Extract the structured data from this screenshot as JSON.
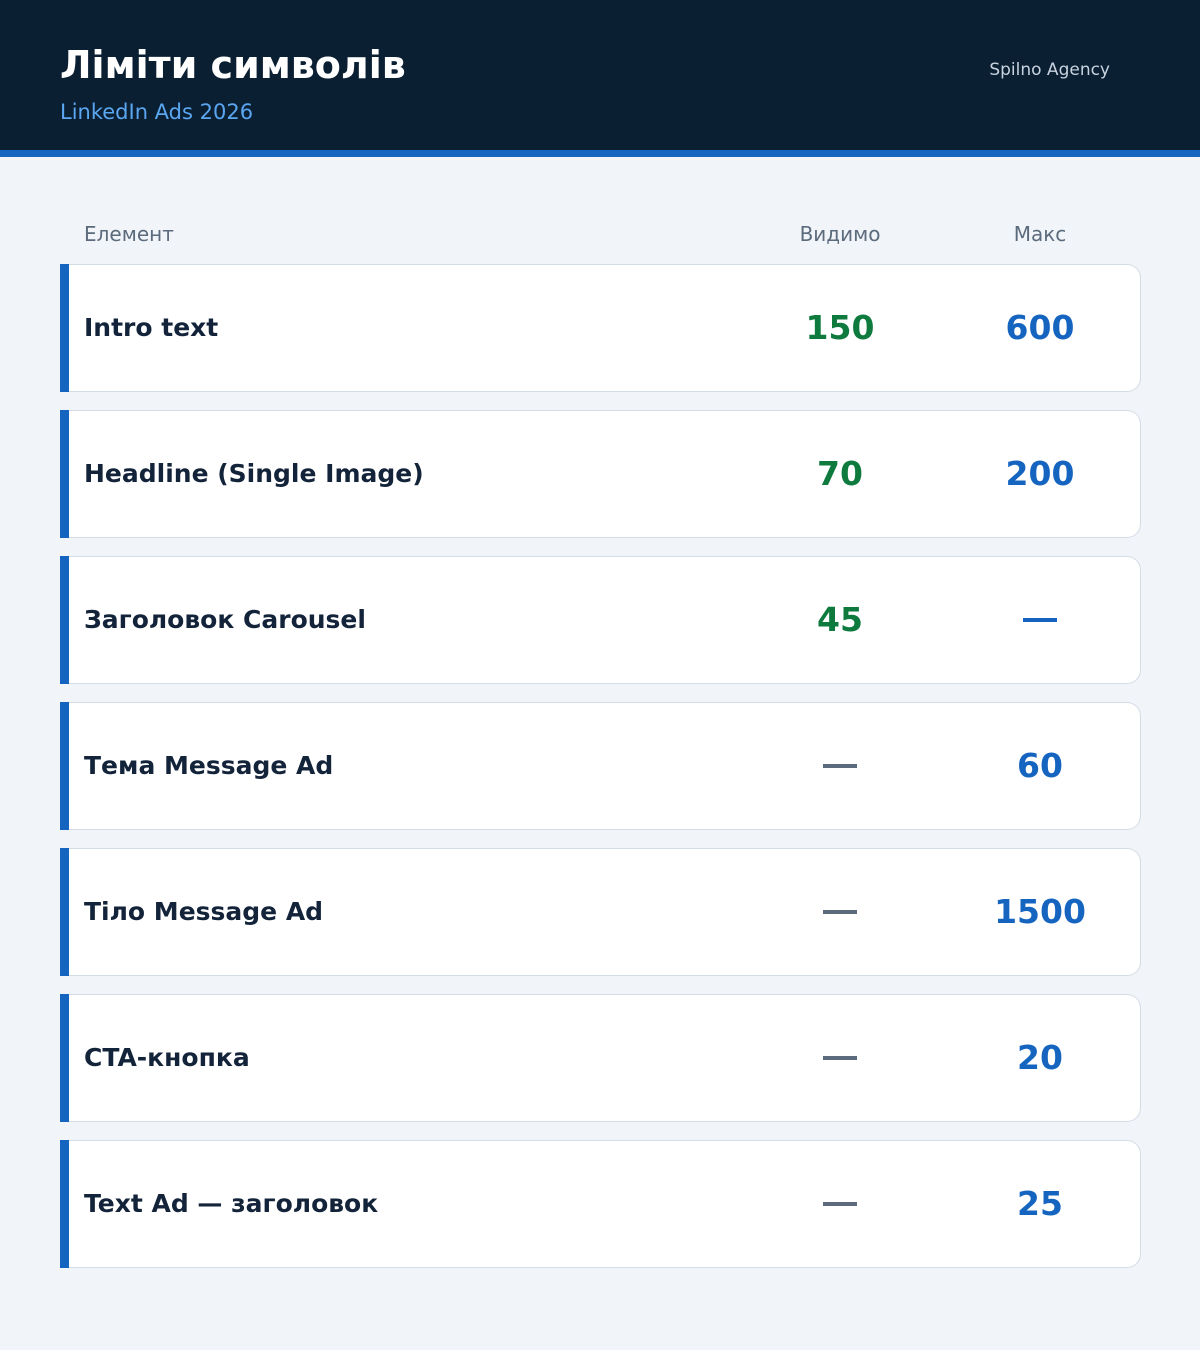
{
  "header": {
    "title": "Ліміти символів",
    "subtitle": "LinkedIn Ads 2026",
    "agency": "Spilno Agency"
  },
  "columns": {
    "element": "Елемент",
    "visible": "Видимо",
    "max": "Макс"
  },
  "rows": [
    {
      "label": "Intro text",
      "visible": "150",
      "max": "600"
    },
    {
      "label": "Headline (Single Image)",
      "visible": "70",
      "max": "200"
    },
    {
      "label": "Заголовок Carousel",
      "visible": "45",
      "max": "—"
    },
    {
      "label": "Тема Message Ad",
      "visible": "—",
      "max": "60"
    },
    {
      "label": "Тіло Message Ad",
      "visible": "—",
      "max": "1500"
    },
    {
      "label": "CTA-кнопка",
      "visible": "—",
      "max": "20"
    },
    {
      "label": "Text Ad — заголовок",
      "visible": "—",
      "max": "25"
    }
  ],
  "colors": {
    "header_bg": "#0b1f33",
    "accent": "#1565c0",
    "visible_value": "#0e7a3e",
    "max_value": "#1565c0"
  }
}
